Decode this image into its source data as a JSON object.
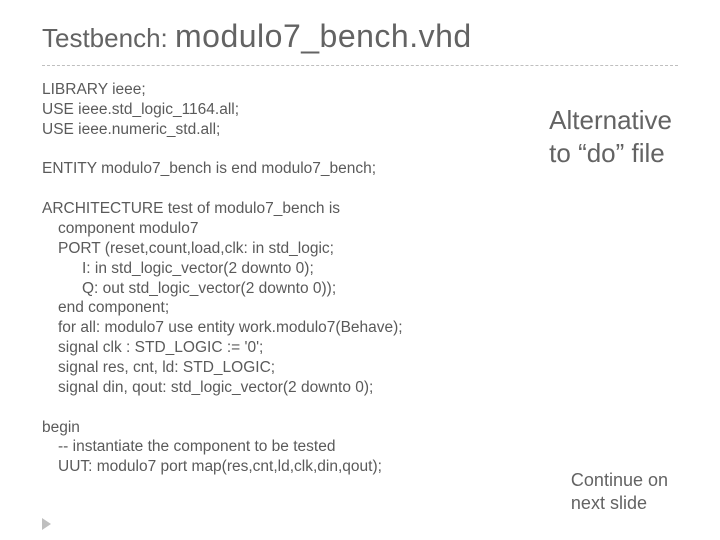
{
  "title": {
    "prefix": "Testbench:",
    "main": "modulo7_bench.vhd"
  },
  "code": {
    "library": [
      "LIBRARY ieee;",
      "USE ieee.std_logic_1164.all;",
      "USE ieee.numeric_std.all;"
    ],
    "entity": "ENTITY modulo7_bench is end modulo7_bench;",
    "arch": [
      "ARCHITECTURE test of modulo7_bench is",
      "component modulo7",
      "PORT (reset,count,load,clk: in std_logic;",
      "I: in  std_logic_vector(2 downto 0);",
      "Q: out std_logic_vector(2 downto 0));",
      "end component;",
      "for all: modulo7 use entity work.modulo7(Behave);",
      "signal clk : STD_LOGIC := '0';",
      "signal res, cnt, ld: STD_LOGIC;",
      "signal din, qout: std_logic_vector(2 downto 0);"
    ],
    "begin": [
      "begin",
      "-- instantiate the component to be tested",
      "UUT: modulo7 port map(res,cnt,ld,clk,din,qout);"
    ]
  },
  "side_note": {
    "line1": "Alternative",
    "line2": "to “do” file"
  },
  "continue_note": {
    "line1": "Continue on",
    "line2": "next slide"
  }
}
